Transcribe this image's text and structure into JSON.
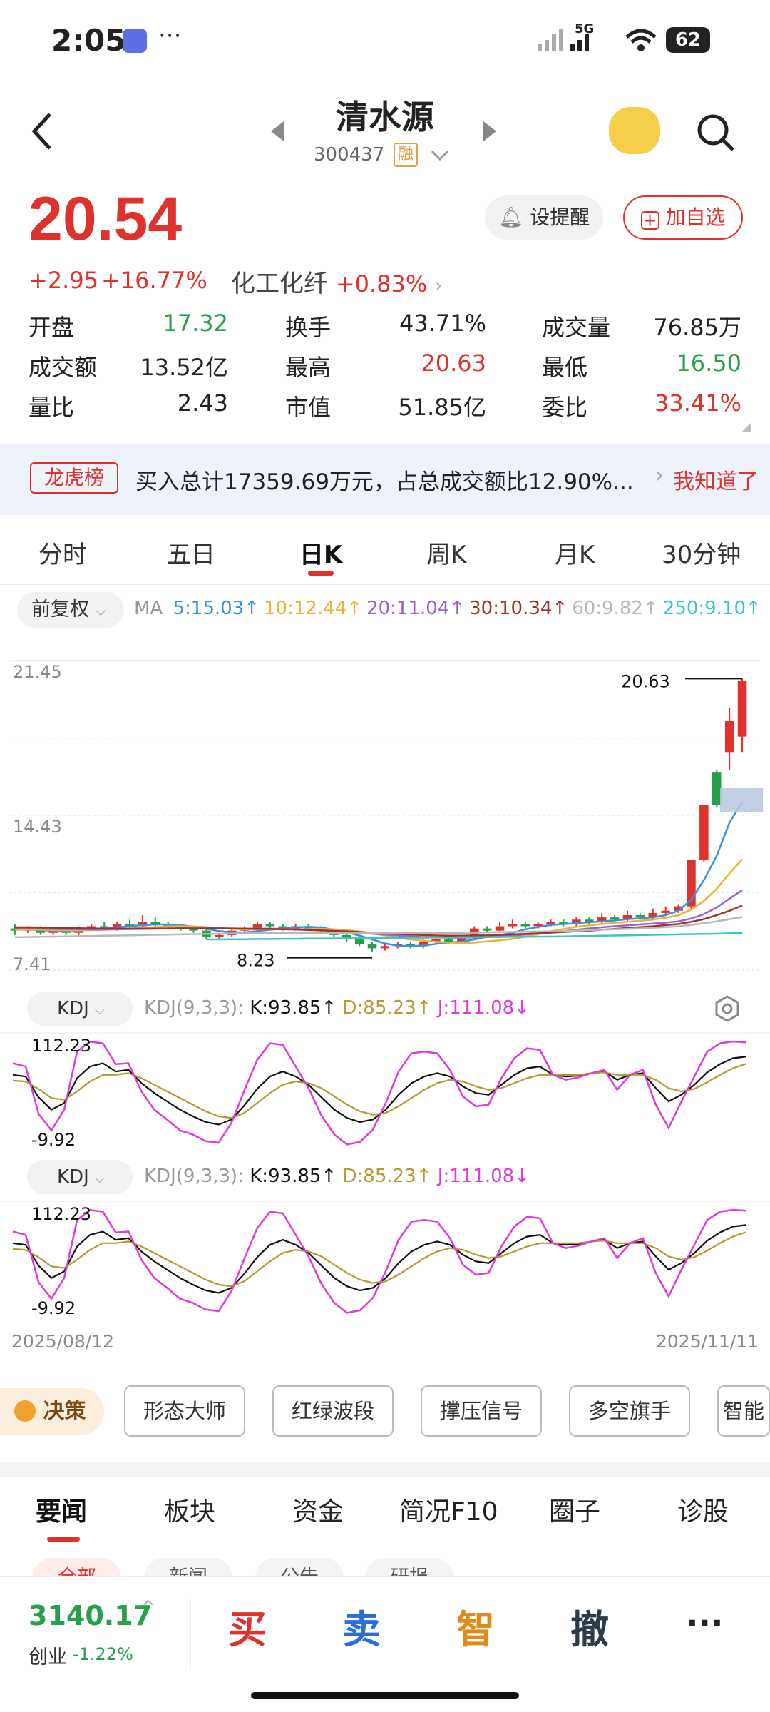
{
  "status_bar": {
    "time": "2:05",
    "more": "···",
    "battery": "62"
  },
  "header": {
    "name": "清水源",
    "code": "300437",
    "rong": "融"
  },
  "quote": {
    "price": "20.54",
    "change": "+2.95",
    "change_pct": "+16.77%",
    "sector": "化工化纤",
    "sector_pct": "+0.83%",
    "alert_label": "设提醒",
    "watch_label": "加自选"
  },
  "stats": [
    {
      "label": "开盘",
      "value": "17.32",
      "color": "#27a04a"
    },
    {
      "label": "换手",
      "value": "43.71%",
      "color": "#222222"
    },
    {
      "label": "成交量",
      "value": "76.85万",
      "color": "#222222"
    },
    {
      "label": "成交额",
      "value": "13.52亿",
      "color": "#222222"
    },
    {
      "label": "最高",
      "value": "20.63",
      "color": "#e0322c"
    },
    {
      "label": "最低",
      "value": "16.50",
      "color": "#27a04a"
    },
    {
      "label": "量比",
      "value": "2.43",
      "color": "#222222"
    },
    {
      "label": "市值",
      "value": "51.85亿",
      "color": "#222222"
    },
    {
      "label": "委比",
      "value": "33.41%",
      "color": "#e0322c"
    }
  ],
  "banner": {
    "tag": "龙虎榜",
    "text": "买入总计17359.69万元，占总成交额比12.90%...",
    "action": "我知道了"
  },
  "period_tabs": [
    "分时",
    "五日",
    "日K",
    "周K",
    "月K",
    "30分钟"
  ],
  "active_tab": "日K",
  "ma_bar": {
    "adjust": "前复权",
    "ma_label": "MA",
    "items": [
      {
        "text": "5:15.03↑",
        "color": "#3d8fe0"
      },
      {
        "text": "10:12.44↑",
        "color": "#e8b531"
      },
      {
        "text": "20:11.04↑",
        "color": "#9a62d0"
      },
      {
        "text": "30:10.34↑",
        "color": "#a0322c"
      },
      {
        "text": "60:9.82↑",
        "color": "#b8b8b8"
      },
      {
        "text": "250:9.10↑",
        "color": "#3fc4c4"
      }
    ]
  },
  "kdj": {
    "name": "KDJ",
    "params": "KDJ(9,3,3):",
    "k": "K:93.85↑",
    "d": "D:85.23↑",
    "j": "J:111.08↓",
    "max_label": "112.23",
    "min_label": "-9.92"
  },
  "chart_data": [
    {
      "type": "candlestick",
      "title": "",
      "y_ticks": [
        "21.45",
        "14.43",
        "7.41"
      ],
      "ylim": [
        7.41,
        21.45
      ],
      "high_label": "20.63",
      "low_label": "8.23",
      "x_labels": [
        "2025/08/12",
        "2025/11/11"
      ],
      "candles": [
        {
          "o": 9.3,
          "c": 9.2,
          "h": 9.5,
          "l": 9.0
        },
        {
          "o": 9.2,
          "c": 9.3,
          "h": 9.4,
          "l": 9.1
        },
        {
          "o": 9.3,
          "c": 9.1,
          "h": 9.4,
          "l": 9.0
        },
        {
          "o": 9.1,
          "c": 9.2,
          "h": 9.3,
          "l": 9.0
        },
        {
          "o": 9.2,
          "c": 9.1,
          "h": 9.3,
          "l": 9.0
        },
        {
          "o": 9.1,
          "c": 9.3,
          "h": 9.4,
          "l": 9.0
        },
        {
          "o": 9.3,
          "c": 9.4,
          "h": 9.5,
          "l": 9.2
        },
        {
          "o": 9.4,
          "c": 9.3,
          "h": 9.6,
          "l": 9.2
        },
        {
          "o": 9.3,
          "c": 9.5,
          "h": 9.6,
          "l": 9.2
        },
        {
          "o": 9.5,
          "c": 9.4,
          "h": 9.7,
          "l": 9.3
        },
        {
          "o": 9.4,
          "c": 9.6,
          "h": 9.9,
          "l": 9.3
        },
        {
          "o": 9.6,
          "c": 9.5,
          "h": 9.8,
          "l": 9.4
        },
        {
          "o": 9.5,
          "c": 9.4,
          "h": 9.6,
          "l": 9.3
        },
        {
          "o": 9.4,
          "c": 9.3,
          "h": 9.5,
          "l": 9.2
        },
        {
          "o": 9.3,
          "c": 9.2,
          "h": 9.4,
          "l": 9.1
        },
        {
          "o": 9.2,
          "c": 8.9,
          "h": 9.3,
          "l": 8.8
        },
        {
          "o": 8.9,
          "c": 9.0,
          "h": 9.1,
          "l": 8.8
        },
        {
          "o": 9.0,
          "c": 9.2,
          "h": 9.3,
          "l": 8.9
        },
        {
          "o": 9.2,
          "c": 9.3,
          "h": 9.4,
          "l": 9.1
        },
        {
          "o": 9.3,
          "c": 9.5,
          "h": 9.6,
          "l": 9.2
        },
        {
          "o": 9.5,
          "c": 9.4,
          "h": 9.6,
          "l": 9.3
        },
        {
          "o": 9.4,
          "c": 9.3,
          "h": 9.5,
          "l": 9.2
        },
        {
          "o": 9.3,
          "c": 9.4,
          "h": 9.5,
          "l": 9.2
        },
        {
          "o": 9.4,
          "c": 9.3,
          "h": 9.5,
          "l": 9.2
        },
        {
          "o": 9.3,
          "c": 9.2,
          "h": 9.4,
          "l": 9.1
        },
        {
          "o": 9.2,
          "c": 9.0,
          "h": 9.3,
          "l": 8.9
        },
        {
          "o": 9.0,
          "c": 8.8,
          "h": 9.1,
          "l": 8.7
        },
        {
          "o": 8.8,
          "c": 8.6,
          "h": 8.9,
          "l": 8.5
        },
        {
          "o": 8.6,
          "c": 8.4,
          "h": 8.7,
          "l": 8.23
        },
        {
          "o": 8.4,
          "c": 8.5,
          "h": 8.6,
          "l": 8.3
        },
        {
          "o": 8.5,
          "c": 8.6,
          "h": 8.7,
          "l": 8.4
        },
        {
          "o": 8.6,
          "c": 8.5,
          "h": 8.7,
          "l": 8.4
        },
        {
          "o": 8.5,
          "c": 8.7,
          "h": 8.8,
          "l": 8.4
        },
        {
          "o": 8.7,
          "c": 8.8,
          "h": 8.9,
          "l": 8.6
        },
        {
          "o": 8.8,
          "c": 8.7,
          "h": 8.9,
          "l": 8.6
        },
        {
          "o": 8.7,
          "c": 8.9,
          "h": 9.0,
          "l": 8.6
        },
        {
          "o": 8.9,
          "c": 9.3,
          "h": 9.4,
          "l": 8.8
        },
        {
          "o": 9.3,
          "c": 9.2,
          "h": 9.4,
          "l": 9.1
        },
        {
          "o": 9.2,
          "c": 9.4,
          "h": 9.6,
          "l": 9.1
        },
        {
          "o": 9.4,
          "c": 9.5,
          "h": 9.7,
          "l": 9.3
        },
        {
          "o": 9.5,
          "c": 9.4,
          "h": 9.6,
          "l": 9.3
        },
        {
          "o": 9.4,
          "c": 9.5,
          "h": 9.6,
          "l": 9.3
        },
        {
          "o": 9.5,
          "c": 9.6,
          "h": 9.7,
          "l": 9.4
        },
        {
          "o": 9.6,
          "c": 9.5,
          "h": 9.7,
          "l": 9.4
        },
        {
          "o": 9.5,
          "c": 9.7,
          "h": 9.8,
          "l": 9.4
        },
        {
          "o": 9.7,
          "c": 9.6,
          "h": 9.8,
          "l": 9.5
        },
        {
          "o": 9.6,
          "c": 9.8,
          "h": 10.0,
          "l": 9.5
        },
        {
          "o": 9.8,
          "c": 9.7,
          "h": 9.9,
          "l": 9.6
        },
        {
          "o": 9.7,
          "c": 9.9,
          "h": 10.1,
          "l": 9.6
        },
        {
          "o": 9.9,
          "c": 9.8,
          "h": 10.0,
          "l": 9.7
        },
        {
          "o": 9.8,
          "c": 10.0,
          "h": 10.2,
          "l": 9.7
        },
        {
          "o": 10.0,
          "c": 10.1,
          "h": 10.3,
          "l": 9.9
        },
        {
          "o": 10.1,
          "c": 10.3,
          "h": 10.4,
          "l": 10.0
        },
        {
          "o": 10.3,
          "c": 12.4,
          "h": 12.4,
          "l": 10.2
        },
        {
          "o": 12.4,
          "c": 14.9,
          "h": 14.9,
          "l": 12.3
        },
        {
          "o": 16.4,
          "c": 14.9,
          "h": 16.5,
          "l": 14.8
        },
        {
          "o": 17.3,
          "c": 18.7,
          "h": 19.3,
          "l": 16.5
        },
        {
          "o": 18.0,
          "c": 20.54,
          "h": 20.63,
          "l": 17.3
        }
      ],
      "ma_series": [
        {
          "name": "MA5",
          "color": "#3d8fe0",
          "values": [
            9.25,
            9.25,
            9.22,
            9.2,
            9.2,
            9.2,
            9.25,
            9.3,
            9.35,
            9.4,
            9.45,
            9.48,
            9.48,
            9.45,
            9.38,
            9.28,
            9.18,
            9.12,
            9.12,
            9.18,
            9.24,
            9.3,
            9.35,
            9.37,
            9.34,
            9.24,
            9.12,
            8.98,
            8.8,
            8.62,
            8.52,
            8.5,
            8.52,
            8.6,
            8.66,
            8.7,
            8.8,
            8.92,
            9.0,
            9.1,
            9.26,
            9.36,
            9.46,
            9.5,
            9.54,
            9.58,
            9.62,
            9.66,
            9.72,
            9.76,
            9.8,
            9.9,
            10.1,
            10.6,
            11.5,
            12.6,
            14.1,
            15.03
          ]
        },
        {
          "name": "MA10",
          "color": "#e8b531",
          "values": [
            9.25,
            9.25,
            9.24,
            9.23,
            9.22,
            9.22,
            9.22,
            9.24,
            9.27,
            9.3,
            9.33,
            9.36,
            9.39,
            9.4,
            9.39,
            9.36,
            9.32,
            9.28,
            9.26,
            9.26,
            9.26,
            9.26,
            9.26,
            9.27,
            9.28,
            9.26,
            9.22,
            9.16,
            9.08,
            8.98,
            8.88,
            8.8,
            8.74,
            8.7,
            8.66,
            8.64,
            8.66,
            8.71,
            8.76,
            8.83,
            8.92,
            9.04,
            9.17,
            9.28,
            9.37,
            9.44,
            9.5,
            9.55,
            9.6,
            9.65,
            9.7,
            9.78,
            9.9,
            10.15,
            10.55,
            11.1,
            11.8,
            12.44
          ]
        },
        {
          "name": "MA20",
          "color": "#9a62d0",
          "values": [
            9.3,
            9.3,
            9.29,
            9.28,
            9.27,
            9.26,
            9.25,
            9.25,
            9.26,
            9.27,
            9.28,
            9.29,
            9.3,
            9.31,
            9.32,
            9.32,
            9.31,
            9.3,
            9.29,
            9.29,
            9.29,
            9.28,
            9.27,
            9.25,
            9.22,
            9.18,
            9.14,
            9.1,
            9.06,
            9.02,
            8.98,
            8.94,
            8.91,
            8.89,
            8.88,
            8.88,
            8.89,
            8.91,
            8.94,
            8.98,
            9.02,
            9.07,
            9.12,
            9.18,
            9.24,
            9.3,
            9.35,
            9.4,
            9.44,
            9.48,
            9.52,
            9.56,
            9.62,
            9.75,
            9.95,
            10.25,
            10.65,
            11.04
          ]
        },
        {
          "name": "MA30",
          "color": "#a0322c",
          "values": [
            9.35,
            9.35,
            9.34,
            9.33,
            9.32,
            9.31,
            9.3,
            9.29,
            9.29,
            9.29,
            9.29,
            9.29,
            9.3,
            9.3,
            9.3,
            9.3,
            9.3,
            9.3,
            9.29,
            9.28,
            9.27,
            9.26,
            9.25,
            9.23,
            9.21,
            9.19,
            9.17,
            9.14,
            9.11,
            9.08,
            9.05,
            9.02,
            9.0,
            8.98,
            8.97,
            8.97,
            8.98,
            8.99,
            9.01,
            9.03,
            9.05,
            9.08,
            9.11,
            9.14,
            9.17,
            9.2,
            9.24,
            9.28,
            9.32,
            9.36,
            9.4,
            9.45,
            9.5,
            9.6,
            9.72,
            9.9,
            10.1,
            10.34
          ]
        },
        {
          "name": "MA60",
          "color": "#b8b8b8",
          "values": [
            8.9,
            8.91,
            8.92,
            8.93,
            8.94,
            8.95,
            8.96,
            8.97,
            8.98,
            8.99,
            9.0,
            9.01,
            9.02,
            9.03,
            9.04,
            9.05,
            9.06,
            9.07,
            9.08,
            9.09,
            9.1,
            9.1,
            9.1,
            9.1,
            9.1,
            9.1,
            9.1,
            9.1,
            9.1,
            9.1,
            9.1,
            9.1,
            9.1,
            9.1,
            9.1,
            9.1,
            9.11,
            9.12,
            9.13,
            9.14,
            9.15,
            9.16,
            9.17,
            9.18,
            9.2,
            9.22,
            9.24,
            9.26,
            9.28,
            9.3,
            9.33,
            9.36,
            9.4,
            9.46,
            9.54,
            9.62,
            9.72,
            9.82
          ]
        },
        {
          "name": "MA250",
          "color": "#3fc4c4",
          "values": [
            null,
            null,
            null,
            null,
            null,
            null,
            null,
            null,
            null,
            null,
            null,
            null,
            null,
            null,
            null,
            8.8,
            8.8,
            8.81,
            8.81,
            8.82,
            8.82,
            8.83,
            8.83,
            8.84,
            8.84,
            8.85,
            8.85,
            8.86,
            8.86,
            8.87,
            8.87,
            8.88,
            8.88,
            8.89,
            8.89,
            8.9,
            8.9,
            8.91,
            8.91,
            8.92,
            8.92,
            8.93,
            8.93,
            8.94,
            8.95,
            8.96,
            8.97,
            8.98,
            8.99,
            9.0,
            9.01,
            9.02,
            9.03,
            9.04,
            9.05,
            9.06,
            9.08,
            9.1
          ]
        }
      ]
    },
    {
      "type": "line",
      "title": "",
      "ylim": [
        -9.92,
        112.23
      ],
      "series": [
        {
          "name": "K",
          "color": "#111111",
          "values": [
            72,
            70,
            45,
            30,
            38,
            68,
            82,
            86,
            76,
            78,
            62,
            50,
            40,
            30,
            22,
            15,
            12,
            18,
            35,
            55,
            70,
            76,
            70,
            60,
            45,
            30,
            20,
            15,
            18,
            30,
            48,
            62,
            70,
            74,
            70,
            58,
            50,
            48,
            60,
            72,
            80,
            82,
            72,
            70,
            71,
            74,
            76,
            66,
            72,
            74,
            56,
            40,
            48,
            60,
            75,
            85,
            92,
            93.85
          ]
        },
        {
          "name": "D",
          "color": "#b39a2e",
          "values": [
            65,
            64,
            55,
            44,
            42,
            52,
            64,
            72,
            72,
            74,
            68,
            60,
            52,
            44,
            36,
            28,
            22,
            20,
            26,
            38,
            50,
            60,
            64,
            62,
            56,
            46,
            36,
            28,
            24,
            26,
            34,
            44,
            54,
            62,
            66,
            64,
            58,
            54,
            56,
            62,
            68,
            72,
            72,
            72,
            72,
            74,
            75,
            72,
            72,
            72,
            66,
            56,
            52,
            55,
            63,
            72,
            80,
            85.23
          ]
        },
        {
          "name": "J",
          "color": "#e03ad8",
          "values": [
            86,
            82,
            25,
            5,
            30,
            100,
            112,
            110,
            85,
            86,
            52,
            30,
            18,
            5,
            0,
            -8,
            -9.92,
            14,
            53,
            90,
            110,
            108,
            82,
            56,
            23,
            0,
            -12,
            -9,
            6,
            38,
            76,
            98,
            100,
            98,
            78,
            46,
            34,
            36,
            68,
            92,
            104,
            102,
            72,
            66,
            69,
            74,
            78,
            54,
            72,
            78,
            36,
            8,
            40,
            70,
            100,
            110,
            112.23,
            111.08
          ]
        }
      ]
    }
  ],
  "tool_chips": {
    "decide": "决策",
    "items": [
      "形态大师",
      "红绿波段",
      "撑压信号",
      "多空旗手",
      "智能"
    ]
  },
  "news_tabs": [
    "要闻",
    "板块",
    "资金",
    "简况F10",
    "圈子",
    "诊股"
  ],
  "sub_tabs": [
    "全部",
    "新闻",
    "公告",
    "研报"
  ],
  "bottom": {
    "index_value": "3140.17",
    "index_name": "创业",
    "index_pct": "-1.22%",
    "buy": "买",
    "sell": "卖",
    "smart": "智",
    "cancel": "撤",
    "more": "···"
  }
}
